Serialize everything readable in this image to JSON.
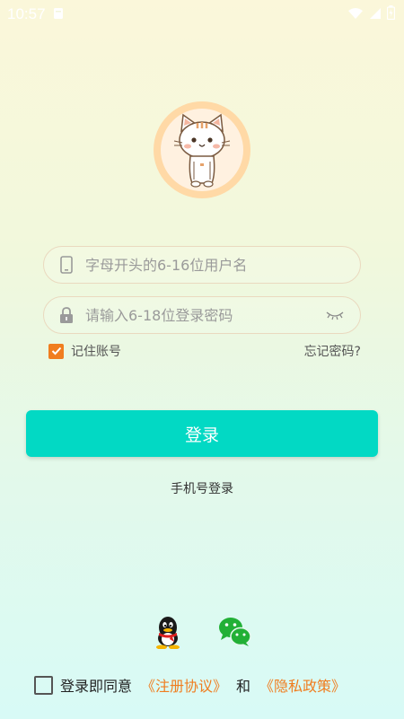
{
  "status_bar": {
    "time": "10:57"
  },
  "login": {
    "username_placeholder": "字母开头的6-16位用户名",
    "password_placeholder": "请输入6-18位登录密码",
    "remember_label": "记住账号",
    "forgot_label": "忘记密码?",
    "login_button": "登录",
    "phone_login": "手机号登录"
  },
  "agreement": {
    "prefix": "登录即同意",
    "terms_link": "《注册协议》",
    "and": "和",
    "privacy_link": "《隐私政策》"
  },
  "colors": {
    "accent": "#02d9c4",
    "link": "#f07d1f",
    "checkbox": "#f07d1f"
  },
  "icons": [
    "signal-icon",
    "wifi-icon",
    "battery-icon",
    "phone-icon",
    "lock-icon",
    "eye-closed-icon",
    "qq-icon",
    "wechat-icon"
  ]
}
